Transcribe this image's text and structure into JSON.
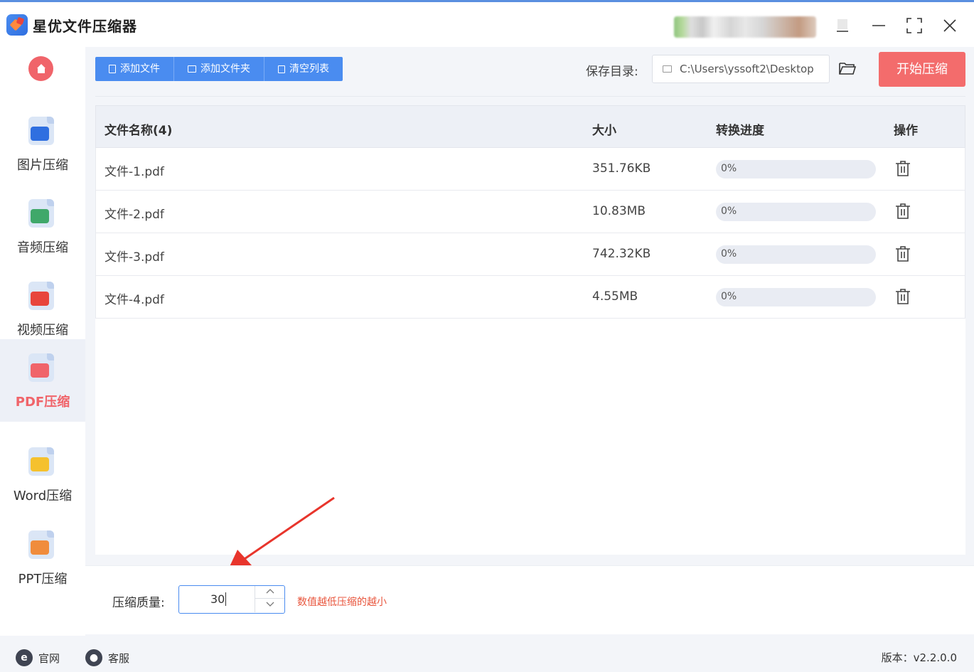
{
  "app": {
    "title": "星优文件压缩器"
  },
  "sidebar": {
    "items": [
      {
        "label": "图片压缩",
        "icon": "image-icon",
        "color": "#2f6fe0",
        "active": false
      },
      {
        "label": "音频压缩",
        "icon": "music-icon",
        "color": "#3fa86a",
        "active": false
      },
      {
        "label": "视频压缩",
        "icon": "video-icon",
        "color": "#e8453c",
        "active": false
      },
      {
        "label": "PDF压缩",
        "icon": "pdf-icon",
        "color": "#f0646a",
        "active": true
      },
      {
        "label": "Word压缩",
        "icon": "word-icon",
        "color": "#f5c12e",
        "active": false
      },
      {
        "label": "PPT压缩",
        "icon": "ppt-icon",
        "color": "#f08c3c",
        "active": false
      }
    ]
  },
  "toolbar": {
    "add_file": "添加文件",
    "add_folder": "添加文件夹",
    "clear_list": "清空列表",
    "save_dir_label": "保存目录:",
    "save_dir_value": "C:\\Users\\yssoft2\\Desktop",
    "start_button": "开始压缩"
  },
  "table": {
    "headers": {
      "name": "文件名称(4)",
      "size": "大小",
      "progress": "转换进度",
      "action": "操作"
    },
    "rows": [
      {
        "name": "文件-1.pdf",
        "size": "351.76KB",
        "progress_text": "0%",
        "progress": 0
      },
      {
        "name": "文件-2.pdf",
        "size": "10.83MB",
        "progress_text": "0%",
        "progress": 0
      },
      {
        "name": "文件-3.pdf",
        "size": "742.32KB",
        "progress_text": "0%",
        "progress": 0
      },
      {
        "name": "文件-4.pdf",
        "size": "4.55MB",
        "progress_text": "0%",
        "progress": 0
      }
    ]
  },
  "settings": {
    "quality_label": "压缩质量:",
    "quality_value": "30",
    "quality_hint": "数值越低压缩的越小"
  },
  "statusbar": {
    "website": "官网",
    "support": "客服",
    "version": "版本：v2.2.0.0"
  },
  "colors": {
    "accent": "#4a8cf0",
    "start_button": "#f36c6c",
    "active_nav": "#f0646a",
    "hint": "#e8553c"
  }
}
